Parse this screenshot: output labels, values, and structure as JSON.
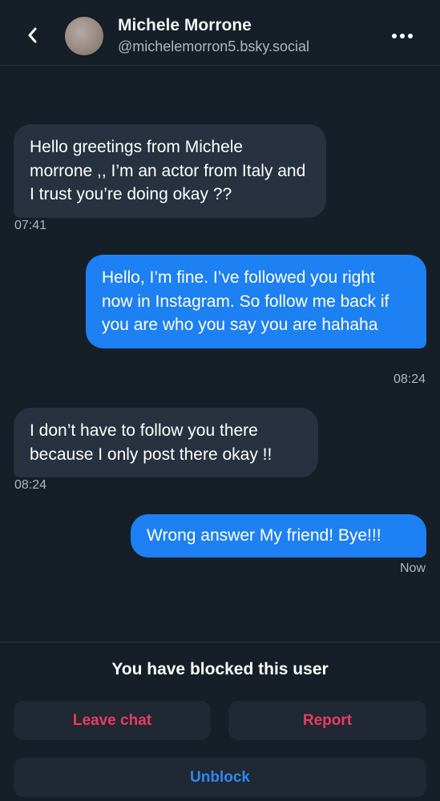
{
  "header": {
    "name": "Michele Morrone",
    "handle": "@michelemorron5.bsky.social",
    "back_icon": "chevron-left-icon",
    "more_icon": "more-horizontal-icon"
  },
  "messages": [
    {
      "direction": "incoming",
      "text": "Hello greetings from Michele morrone ,, I’m an actor from Italy and I trust you’re doing okay ??",
      "time": "07:41"
    },
    {
      "direction": "outgoing",
      "text": "Hello, I’m fine. I’ve followed you right now in Instagram. So follow me back if you are who you say you are hahaha",
      "time": "08:24"
    },
    {
      "direction": "incoming",
      "text": "I don’t have to follow you there because I only post there okay !!",
      "time": "08:24"
    },
    {
      "direction": "outgoing",
      "text": "Wrong answer My friend! Bye!!!",
      "time": "Now"
    }
  ],
  "footer": {
    "blocked_text": "You have blocked this user",
    "leave_label": "Leave chat",
    "report_label": "Report",
    "unblock_label": "Unblock"
  },
  "colors": {
    "background": "#161e27",
    "incoming_bubble": "#27313f",
    "outgoing_bubble": "#1d80f3",
    "danger": "#ea3c61",
    "link": "#2f87ef"
  }
}
